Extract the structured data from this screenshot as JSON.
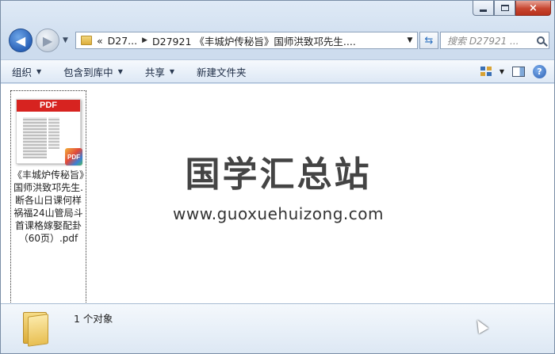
{
  "window": {
    "caption": {
      "minimize": "minimize",
      "maximize": "maximize",
      "close": "×"
    }
  },
  "nav": {
    "back_glyph": "◀",
    "forward_glyph": "▶",
    "breadcrumb": {
      "overflow": "«",
      "parent": "D27...",
      "current": "D27921 《丰城炉传秘旨》国师洪致邛先生...."
    },
    "search_placeholder": "搜索 D27921 ..."
  },
  "commands": {
    "organize": "组织",
    "include_in_library": "包含到库中",
    "share": "共享",
    "new_folder": "新建文件夹"
  },
  "file": {
    "thumb_band": "PDF",
    "badge": "PDF",
    "name": "《丰城炉传秘旨》国师洪致邛先生.断各山日课何样祸福24山管局斗首课格嫁娶配卦（60页）.pdf"
  },
  "watermark": {
    "title": "国学汇总站",
    "url": "www.guoxuehuizong.com"
  },
  "status": {
    "count": "1 个对象"
  }
}
